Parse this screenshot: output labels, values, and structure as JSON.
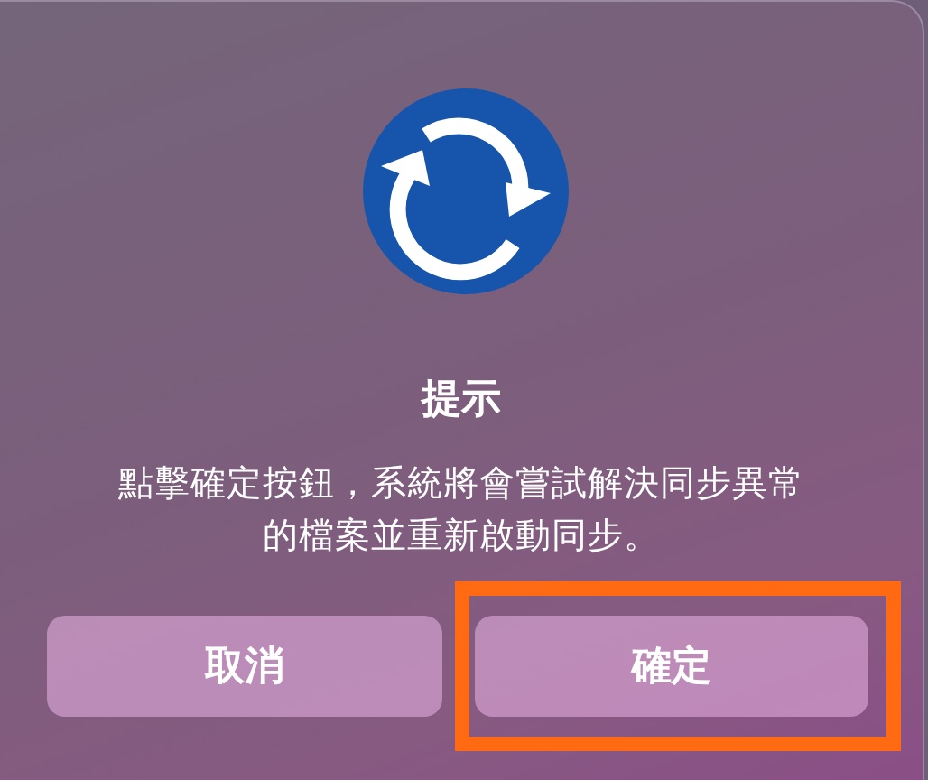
{
  "dialog": {
    "title": "提示",
    "message": "點擊確定按鈕，系統將會嘗試解決同步異常的檔案並重新啟動同步。",
    "buttons": [
      {
        "label": "取消",
        "highlighted": false
      },
      {
        "label": "確定",
        "highlighted": true
      }
    ]
  }
}
